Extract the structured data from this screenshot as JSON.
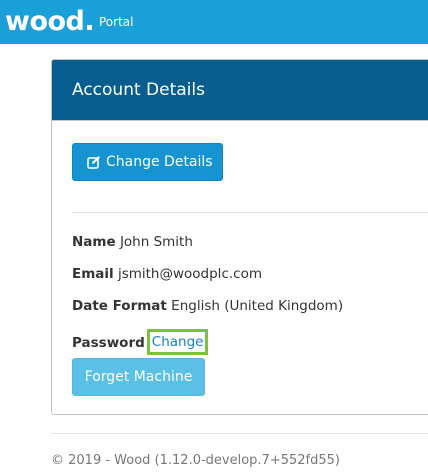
{
  "header": {
    "logo_text": "wood.",
    "nav_link": "Portal",
    "background_color": "#1a9fd9"
  },
  "panel": {
    "title": "Account Details",
    "heading_color": "#075e8e",
    "change_details_button": {
      "label": "Change Details",
      "icon": "edit-icon"
    },
    "fields": {
      "name_label": "Name",
      "name_value": "John Smith",
      "email_label": "Email",
      "email_value": "jsmith@woodplc.com",
      "date_format_label": "Date Format",
      "date_format_value": "English (United Kingdom)",
      "password_label": "Password",
      "password_link": "Change"
    },
    "forget_machine_button": {
      "label": "Forget Machine"
    }
  },
  "footer": {
    "text": "© 2019 - Wood (1.12.0-develop.7+552fd55)"
  }
}
